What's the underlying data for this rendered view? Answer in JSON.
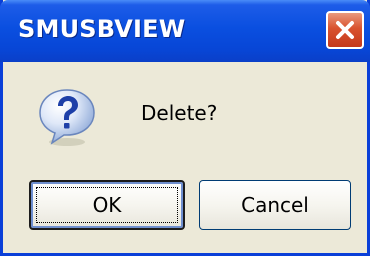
{
  "dialog": {
    "title": "SMUSBVIEW",
    "message": "Delete?",
    "icon": "question-icon",
    "close_icon": "close-icon",
    "buttons": {
      "ok_label": "OK",
      "cancel_label": "Cancel"
    }
  },
  "colors": {
    "titlebar": "#0a4fe0",
    "close_button": "#d9532f",
    "window_background": "#ece9d8"
  }
}
